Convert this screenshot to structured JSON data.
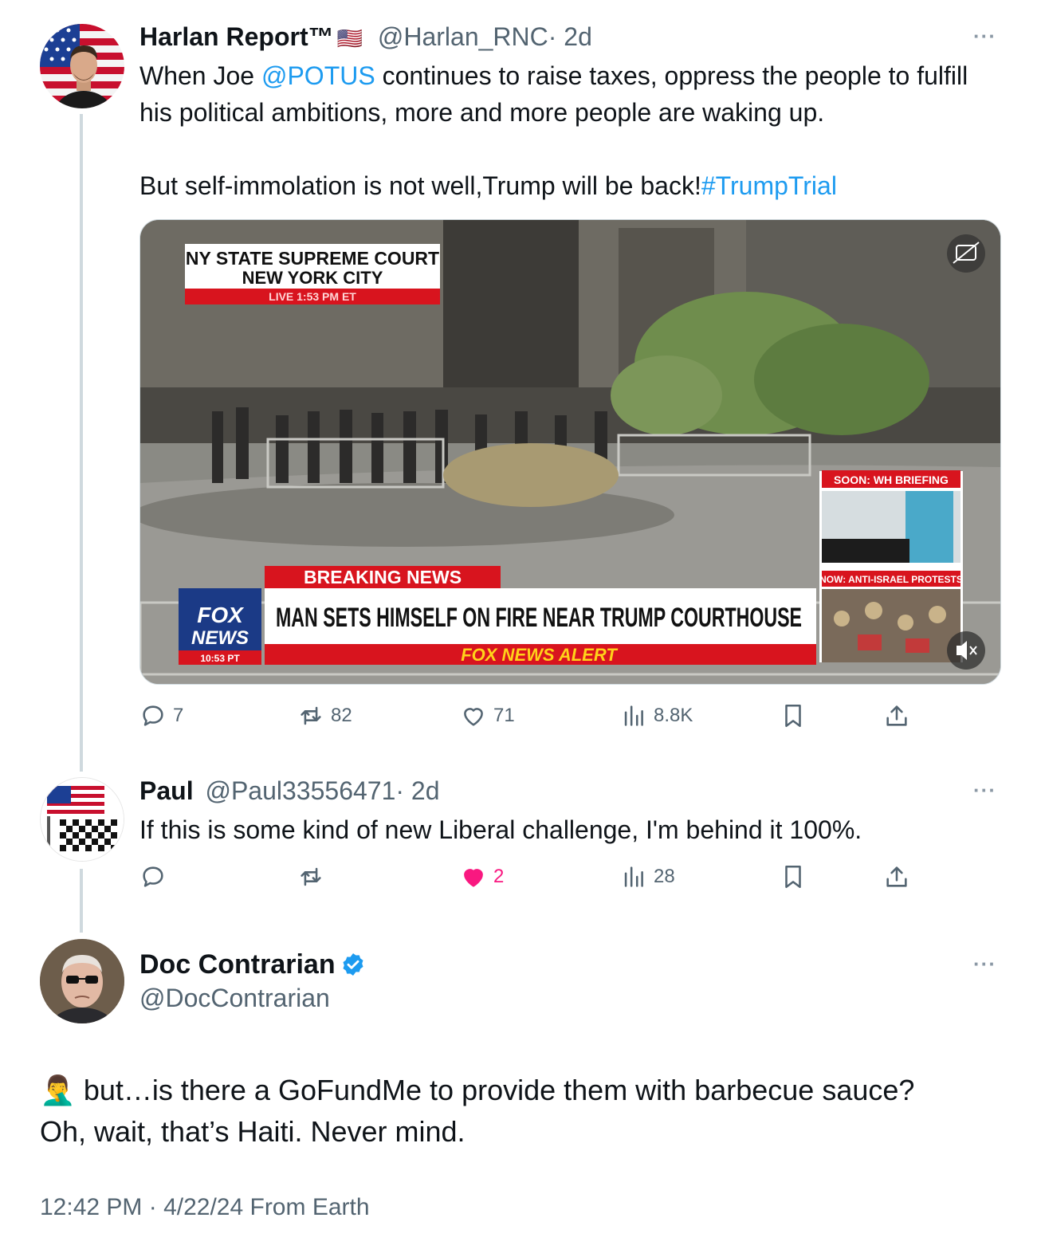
{
  "tweet1": {
    "name": "Harlan Report™",
    "flag": "🇺🇸",
    "handle": "@Harlan_RNC",
    "time": "· 2d",
    "more": "···",
    "text_a": "When Joe ",
    "mention": "@POTUS",
    "text_b": " continues to raise taxes, oppress the people to fulfill his political ambitions, more and more people are waking up.",
    "text_c": "But self-immolation is not well,Trump will be back!",
    "hashtag": "#TrumpTrial",
    "video": {
      "location_line1": "NY STATE SUPREME COURT",
      "location_line2": "NEW YORK CITY",
      "live_time": "LIVE  1:53 PM ET",
      "breaking": "BREAKING NEWS",
      "headline": "MAN SETS HIMSELF ON FIRE NEAR TRUMP COURTHOUSE",
      "alert": "FOX NEWS ALERT",
      "logo_top": "FOX",
      "logo_bottom": "NEWS",
      "logo_time": "10:53 PT",
      "side_top": "SOON: WH BRIEFING",
      "side_bottom": "NOW: ANTI-ISRAEL PROTESTS"
    },
    "replies": "7",
    "reposts": "82",
    "likes": "71",
    "views": "8.8K"
  },
  "tweet2": {
    "name": "Paul",
    "handle": "@Paul33556471",
    "time": "· 2d",
    "more": "···",
    "text": "If this is some kind of new Liberal challenge, I'm behind it 100%.",
    "likes": "2",
    "views": "28"
  },
  "tweet3": {
    "name": "Doc Contrarian",
    "handle": "@DocContrarian",
    "more": "···",
    "emoji": "🤦‍♂️",
    "text_line1": " but…is there a GoFundMe to provide them with barbecue sauce?",
    "text_line2": "Oh, wait, that’s Haiti. Never mind.",
    "footer": "12:42 PM · 4/22/24 From Earth"
  },
  "colors": {
    "link": "#1d9bf0",
    "like_active": "#f91880",
    "secondary": "#536471",
    "verified": "#1d9bf0",
    "fox_red": "#d8141e"
  },
  "icons": [
    "reply-icon",
    "repost-icon",
    "like-icon",
    "views-icon",
    "bookmark-icon",
    "share-icon",
    "verified-icon",
    "mute-icon",
    "captions-icon",
    "more-icon"
  ]
}
